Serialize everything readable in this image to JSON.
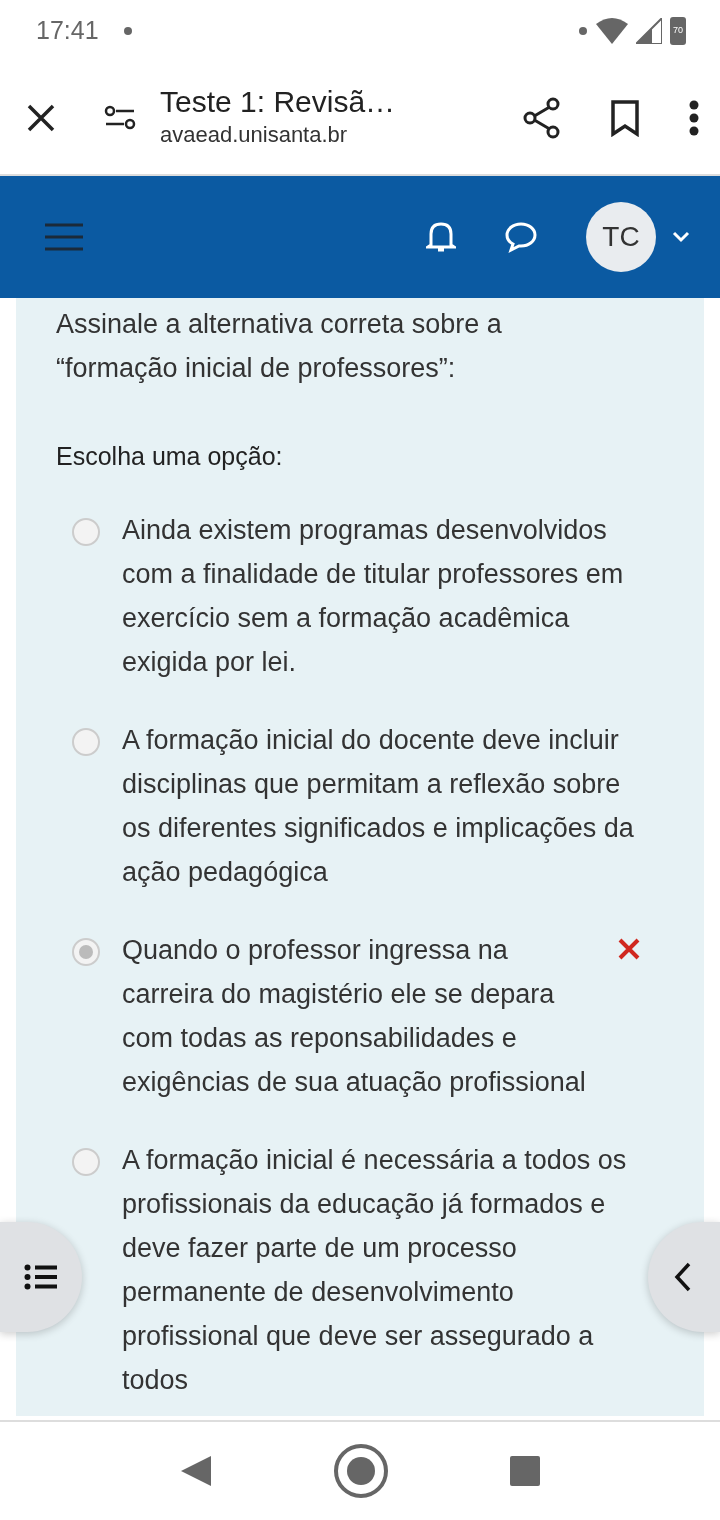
{
  "status_bar": {
    "time": "17:41",
    "battery": "70"
  },
  "browser": {
    "title": "Teste 1: Revisã…",
    "url": "avaead.unisanta.br"
  },
  "header": {
    "avatar_initials": "TC"
  },
  "question": {
    "text": "Assinale a alternativa correta sobre a “formação inicial de professores”:",
    "prompt": "Escolha uma opção:",
    "options": [
      {
        "text": "Ainda existem programas desenvolvidos com a finalidade de titular professores em exercício sem a formação acadêmica exigida por lei.",
        "selected": false,
        "incorrect": false
      },
      {
        "text": "A formação inicial do docente deve incluir disciplinas que permitam a reflexão sobre os diferentes significados e implicações da ação pedagógica",
        "selected": false,
        "incorrect": false
      },
      {
        "text": "Quando o professor ingressa na carreira do magistério ele se depara com todas as reponsabilidades e exigências de sua atuação profissional",
        "selected": true,
        "incorrect": true
      },
      {
        "text": "A formação inicial é necessária a todos os profissionais da educação já formados e deve fazer parte de um processo permanente de desenvolvimento profissional que deve ser assegurado a todos",
        "selected": false,
        "incorrect": false
      }
    ]
  }
}
